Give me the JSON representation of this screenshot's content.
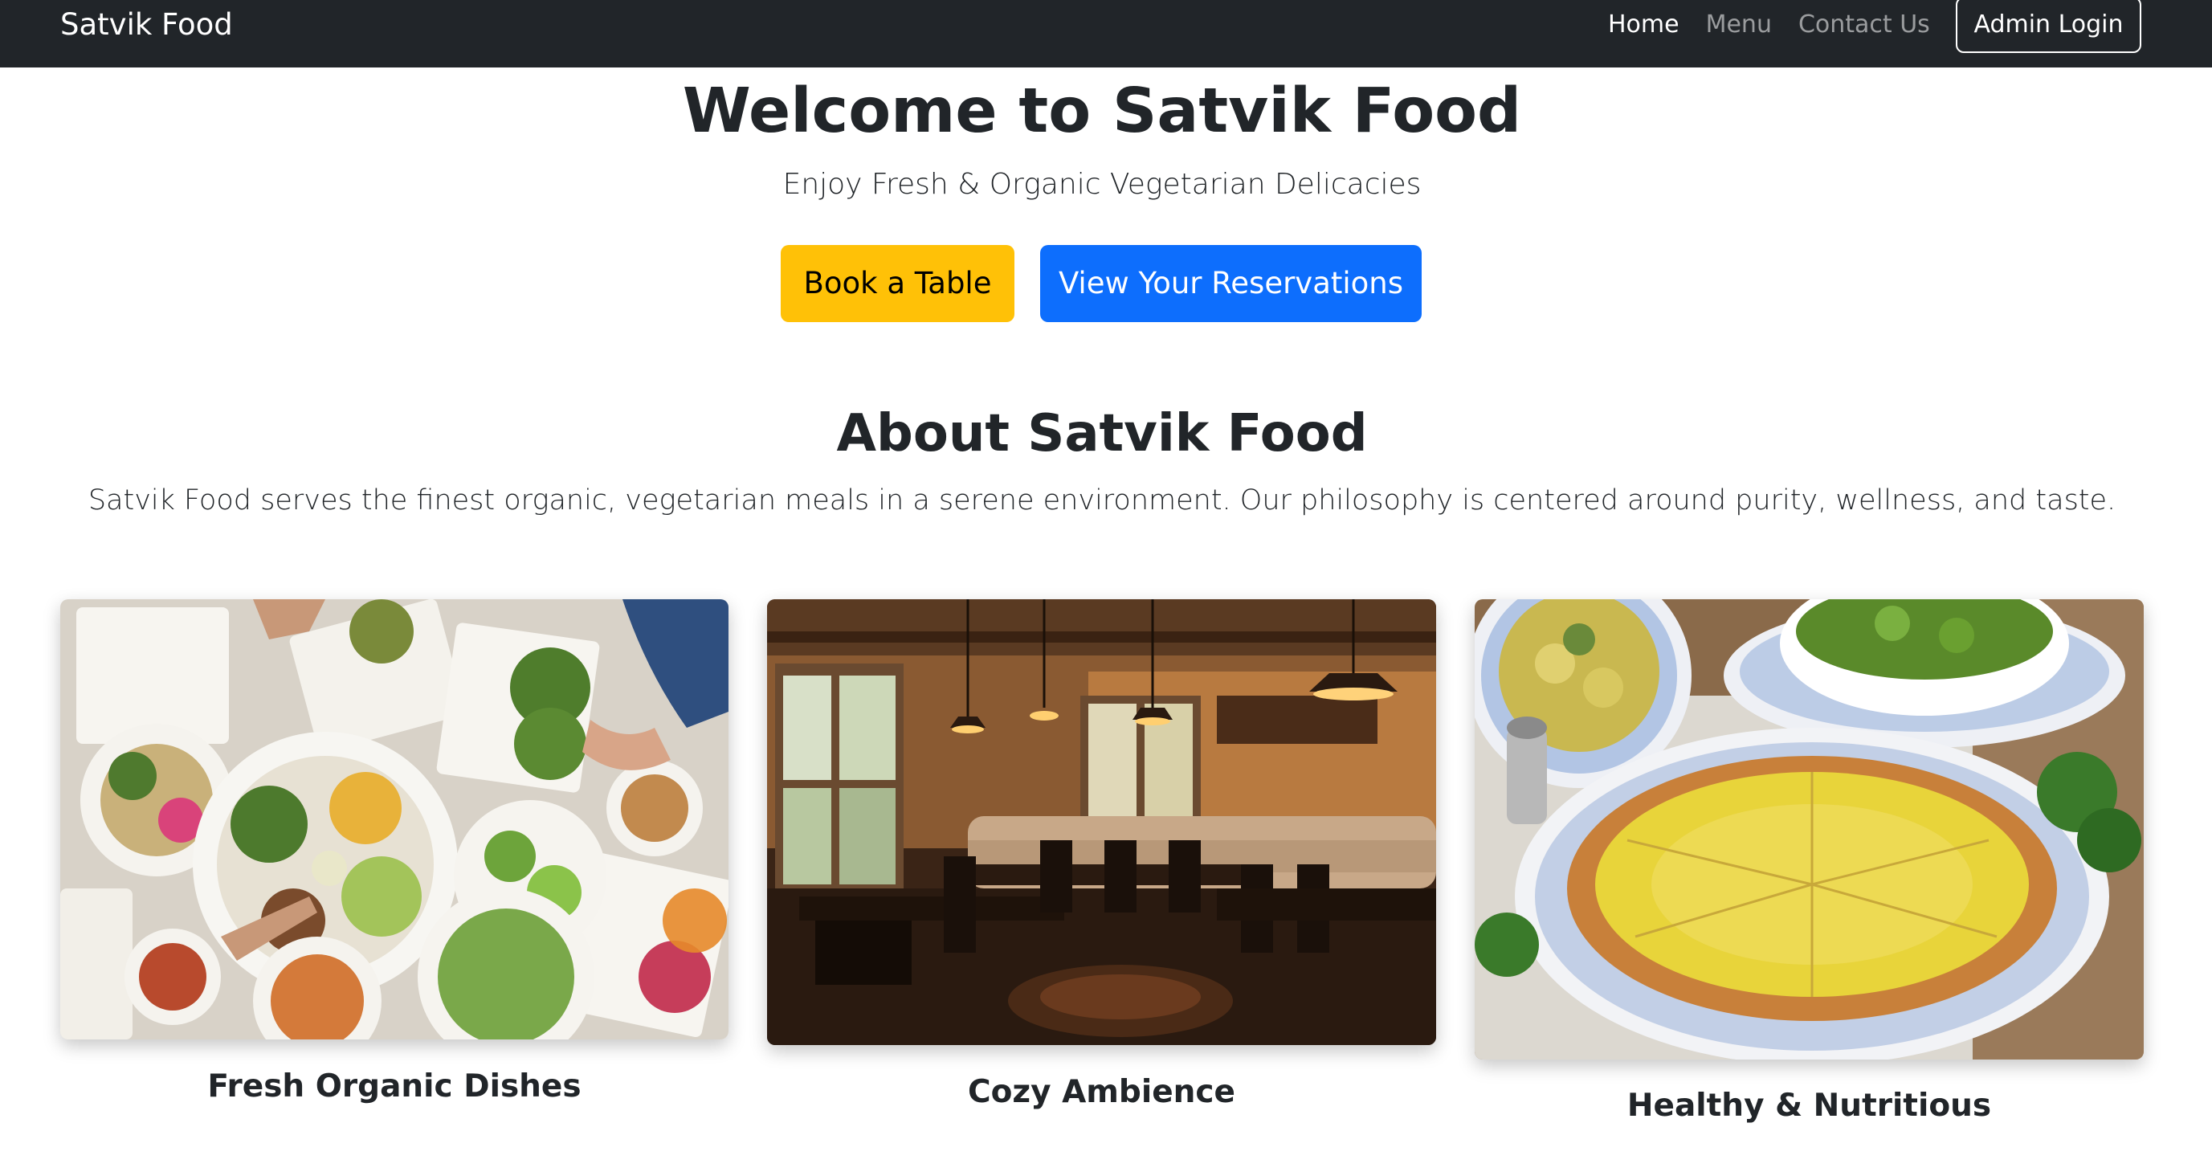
{
  "navbar": {
    "brand": "Satvik Food",
    "links": [
      {
        "label": "Home",
        "active": true
      },
      {
        "label": "Menu",
        "active": false
      },
      {
        "label": "Contact Us",
        "active": false
      }
    ],
    "admin_button": "Admin Login"
  },
  "hero": {
    "title": "Welcome to Satvik Food",
    "subtitle": "Enjoy Fresh & Organic Vegetarian Delicacies",
    "book_button": "Book a Table",
    "reservations_button": "View Your Reservations"
  },
  "about": {
    "title": "About Satvik Food",
    "text": "Satvik Food serves the finest organic, vegetarian meals in a serene environment. Our philosophy is centered around purity, wellness, and taste."
  },
  "cards": [
    {
      "caption": "Fresh Organic Dishes"
    },
    {
      "caption": "Cozy Ambience"
    },
    {
      "caption": "Healthy & Nutritious"
    }
  ],
  "colors": {
    "navbar_bg": "#212529",
    "book_button_bg": "#ffc107",
    "reservations_button_bg": "#0d6efd"
  }
}
